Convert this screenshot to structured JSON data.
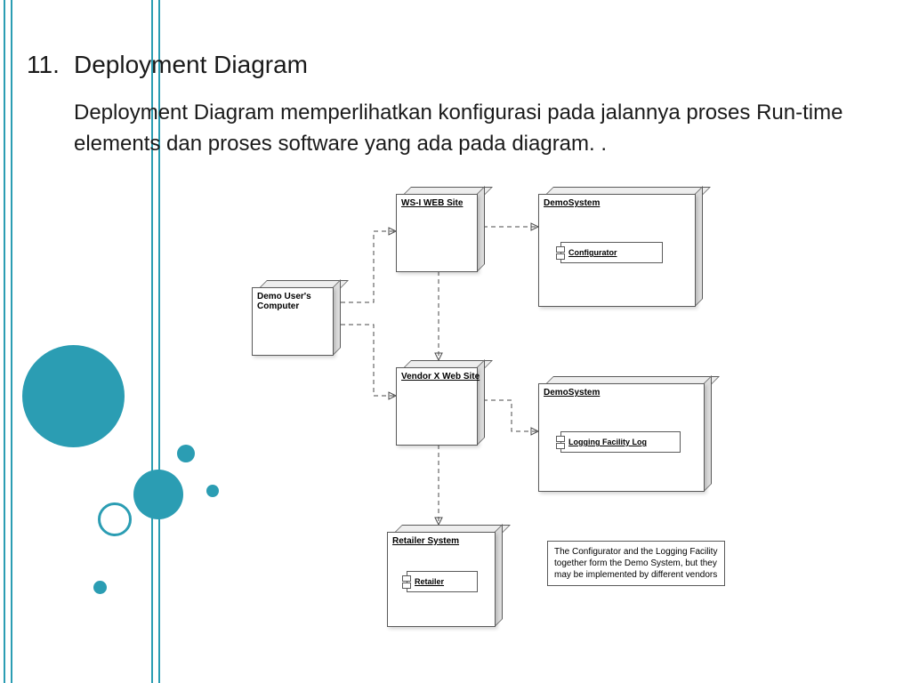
{
  "slide_number": "11.",
  "title": "Deployment Diagram",
  "body": "Deployment Diagram memperlihatkan konfigurasi pada jalannya proses Run-time elements  dan proses software yang ada pada diagram. .",
  "accent_color": "#2b9db3",
  "diagram": {
    "nodes": {
      "user_computer": {
        "label": "Demo User's Computer"
      },
      "wsi_site": {
        "label": "WS-I WEB Site"
      },
      "demosystem_top": {
        "label": "DemoSystem",
        "component": "Configurator"
      },
      "vendorx": {
        "label": "Vendor X Web Site"
      },
      "demosystem_bot": {
        "label": "DemoSystem",
        "component": "Logging Facility Log"
      },
      "retailer_sys": {
        "label": "Retailer System",
        "component": "Retailer"
      }
    },
    "note": "The Configurator and the Logging Facility together form the Demo System, but they may be implemented by different vendors",
    "connections": [
      {
        "from": "user_computer",
        "to": "wsi_site"
      },
      {
        "from": "user_computer",
        "to": "vendorx"
      },
      {
        "from": "wsi_site",
        "to": "demosystem_top"
      },
      {
        "from": "wsi_site",
        "to": "vendorx"
      },
      {
        "from": "vendorx",
        "to": "demosystem_bot"
      },
      {
        "from": "vendorx",
        "to": "retailer_sys"
      }
    ]
  }
}
